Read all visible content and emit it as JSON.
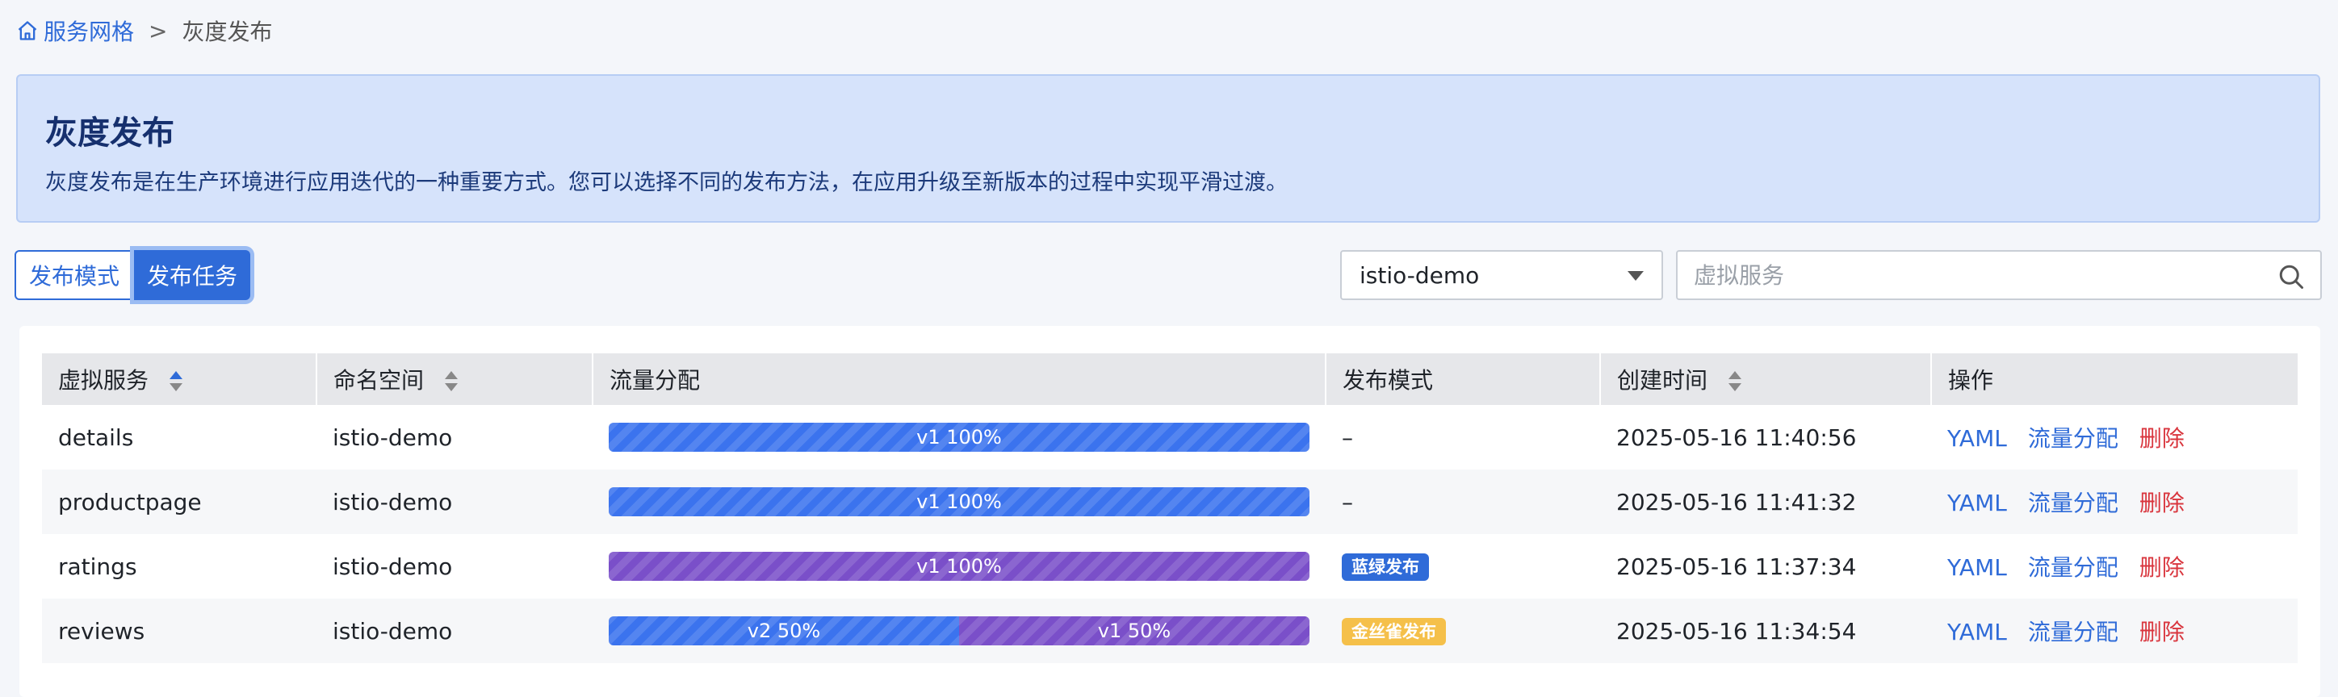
{
  "breadcrumb": {
    "home": "服务网格",
    "separator": ">",
    "current": "灰度发布"
  },
  "banner": {
    "title": "灰度发布",
    "description": "灰度发布是在生产环境进行应用迭代的一种重要方式。您可以选择不同的发布方法，在应用升级至新版本的过程中实现平滑过渡。"
  },
  "tabs": [
    {
      "label": "发布模式",
      "active": false
    },
    {
      "label": "发布任务",
      "active": true
    }
  ],
  "namespace_select": {
    "value": "istio-demo"
  },
  "search": {
    "placeholder": "虚拟服务",
    "value": ""
  },
  "table": {
    "columns": [
      "虚拟服务",
      "命名空间",
      "流量分配",
      "发布模式",
      "创建时间",
      "操作"
    ],
    "rows": [
      {
        "service": "details",
        "namespace": "istio-demo",
        "traffic": [
          {
            "label": "v1 100%",
            "percent": 100,
            "color": "blue"
          }
        ],
        "mode": "–",
        "mode_type": "none",
        "created": "2025-05-16 11:40:56"
      },
      {
        "service": "productpage",
        "namespace": "istio-demo",
        "traffic": [
          {
            "label": "v1 100%",
            "percent": 100,
            "color": "blue"
          }
        ],
        "mode": "–",
        "mode_type": "none",
        "created": "2025-05-16 11:41:32"
      },
      {
        "service": "ratings",
        "namespace": "istio-demo",
        "traffic": [
          {
            "label": "v1 100%",
            "percent": 100,
            "color": "purple"
          }
        ],
        "mode": "蓝绿发布",
        "mode_type": "bluegreen",
        "created": "2025-05-16 11:37:34"
      },
      {
        "service": "reviews",
        "namespace": "istio-demo",
        "traffic": [
          {
            "label": "v2 50%",
            "percent": 50,
            "color": "blue"
          },
          {
            "label": "v1 50%",
            "percent": 50,
            "color": "purple"
          }
        ],
        "mode": "金丝雀发布",
        "mode_type": "canary",
        "created": "2025-05-16 11:34:54"
      }
    ],
    "actions": {
      "yaml": "YAML",
      "traffic": "流量分配",
      "delete": "删除"
    }
  },
  "colors": {
    "accent": "#2f6bd8",
    "purple": "#7a4fc9",
    "canary": "#f5c04a",
    "danger": "#d9363e"
  }
}
